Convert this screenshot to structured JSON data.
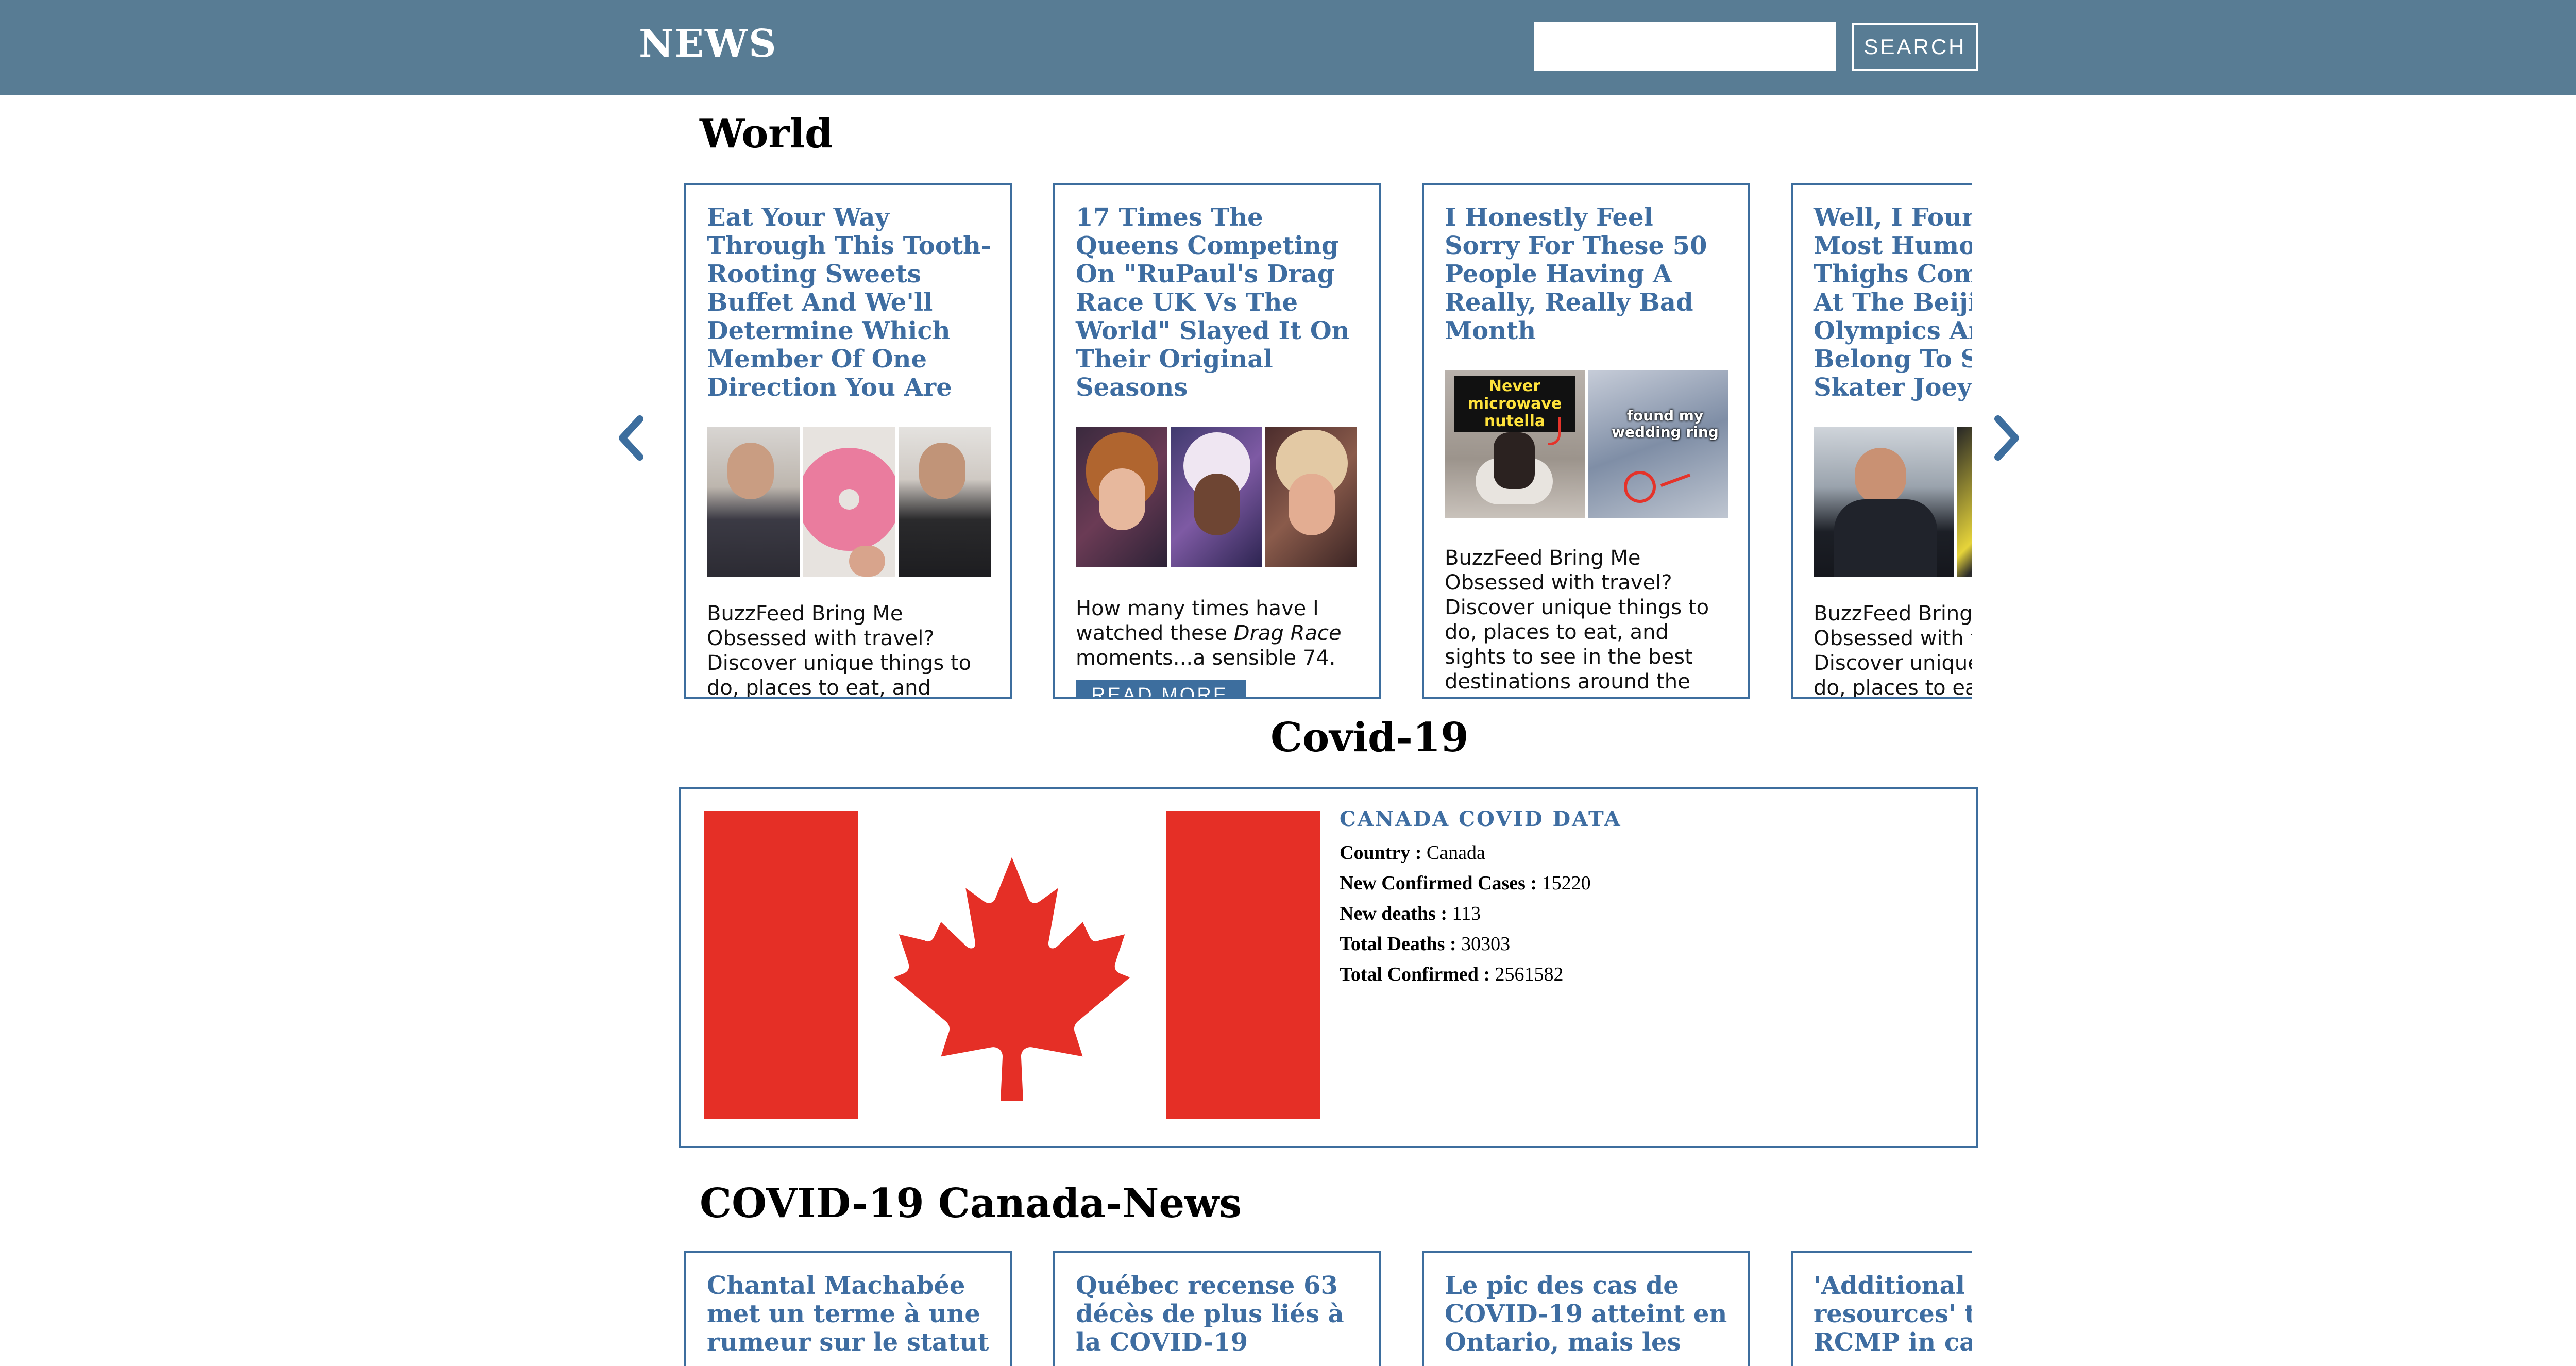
{
  "header": {
    "brand": "NEWS",
    "search_placeholder": "",
    "search_label": "SEARCH"
  },
  "world": {
    "title": "World",
    "read_more_label": "READ MORE",
    "articles": [
      {
        "title": "Eat Your Way Through This Tooth-Rooting Sweets Buffet And We'll Determine Which Member Of One Direction You Are",
        "description": "BuzzFeed Bring Me Obsessed with travel? Discover unique things to do, places to eat, and sights"
      },
      {
        "title": "17 Times The Queens Competing On \"RuPaul's Drag Race UK Vs The World\" Slayed It On Their Original Seasons",
        "description_before": "How many times have I watched these ",
        "description_em": "Drag Race",
        "description_after": " moments...a sensible 74."
      },
      {
        "title": "I Honestly Feel Sorry For These 50 People Having A Really, Really Bad Month",
        "image_caption_1": "Never microwave nutella",
        "image_caption_2": "found my wedding ring",
        "description": "BuzzFeed Bring Me Obsessed with travel? Discover unique things to do, places to eat, and sights to see in the best destinations around the"
      },
      {
        "title": "Well, I Found The Most Humongous Thighs Competing At The Beijing Olympics And They Belong To Speed Skater Joey",
        "description": "BuzzFeed Bring Me Obsessed with travel? Discover unique things to do, places to eat"
      }
    ]
  },
  "covid": {
    "title": "Covid-19",
    "heading": "CANADA COVID DATA",
    "rows": [
      {
        "label": "Country :",
        "value": "Canada"
      },
      {
        "label": "New Confirmed Cases :",
        "value": "15220"
      },
      {
        "label": "New deaths :",
        "value": "113"
      },
      {
        "label": "Total Deaths :",
        "value": "30303"
      },
      {
        "label": "Total Confirmed :",
        "value": "2561582"
      }
    ]
  },
  "canada_news": {
    "title": "COVID-19 Canada-News",
    "articles": [
      {
        "title": "Chantal Machabée met un terme à une rumeur sur le statut"
      },
      {
        "title": "Québec recense 63 décès de plus liés à la COVID-19"
      },
      {
        "title": "Le pic des cas de COVID-19 atteint en Ontario, mais les"
      },
      {
        "title": "'Additional resources' taken by RCMP in case"
      }
    ]
  },
  "colors": {
    "header_bg": "#587c94",
    "accent": "#3e6da1",
    "flag_red": "#e52f26"
  }
}
